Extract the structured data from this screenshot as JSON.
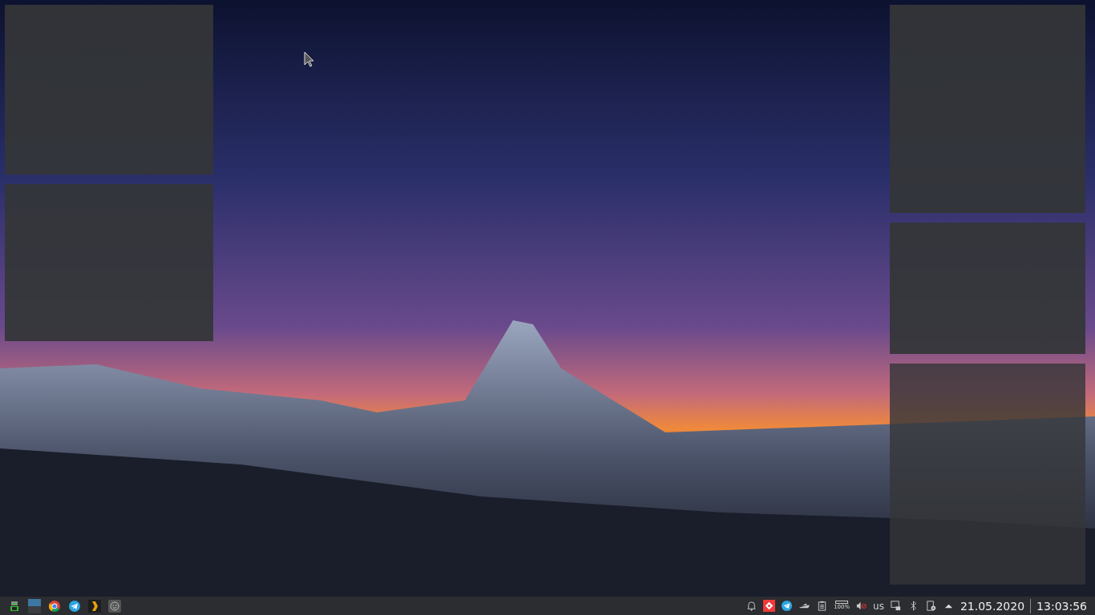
{
  "pager": {
    "desktops": [
      {
        "selected": true
      },
      {
        "selected": false
      }
    ]
  },
  "tray": {
    "battery_label": "100%",
    "keyboard_layout": "us"
  },
  "clock": {
    "date": "21.05.2020",
    "time": "13:03:56"
  }
}
